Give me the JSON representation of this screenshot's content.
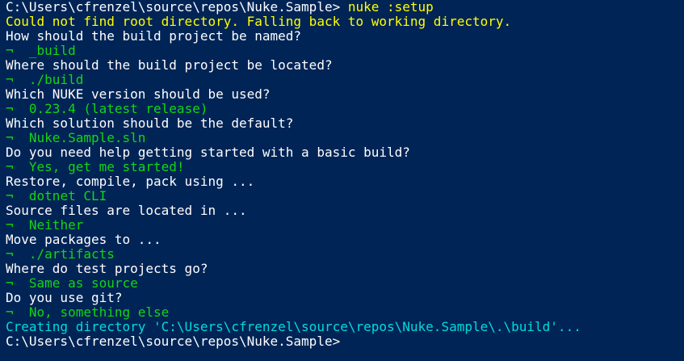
{
  "terminal": {
    "prompt_path": "C:\\Users\\cfrenzel\\source\\repos\\Nuke.Sample>",
    "command": " nuke :setup",
    "warning": "Could not find root directory. Falling back to working directory.",
    "marker": "¬",
    "qa": [
      {
        "question": "How should the build project be named?",
        "answer": "_build"
      },
      {
        "question": "Where should the build project be located?",
        "answer": "./build"
      },
      {
        "question": "Which NUKE version should be used?",
        "answer": "0.23.4 (latest release)"
      },
      {
        "question": "Which solution should be the default?",
        "answer": "Nuke.Sample.sln"
      },
      {
        "question": "Do you need help getting started with a basic build?",
        "answer": "Yes, get me started!"
      },
      {
        "question": "Restore, compile, pack using ...",
        "answer": "dotnet CLI"
      },
      {
        "question": "Source files are located in ...",
        "answer": "Neither"
      },
      {
        "question": "Move packages to ...",
        "answer": "./artifacts"
      },
      {
        "question": "Where do test projects go?",
        "answer": "Same as source"
      },
      {
        "question": "Do you use git?",
        "answer": "No, something else"
      }
    ],
    "creating": "Creating directory 'C:\\Users\\cfrenzel\\source\\repos\\Nuke.Sample\\.\\build'...",
    "final_prompt": "C:\\Users\\cfrenzel\\source\\repos\\Nuke.Sample>"
  },
  "colors": {
    "background": "#012456",
    "text": "#ffffff",
    "command": "#ffff00",
    "warning": "#ffff00",
    "answer": "#13d613",
    "info": "#00dcdc"
  }
}
